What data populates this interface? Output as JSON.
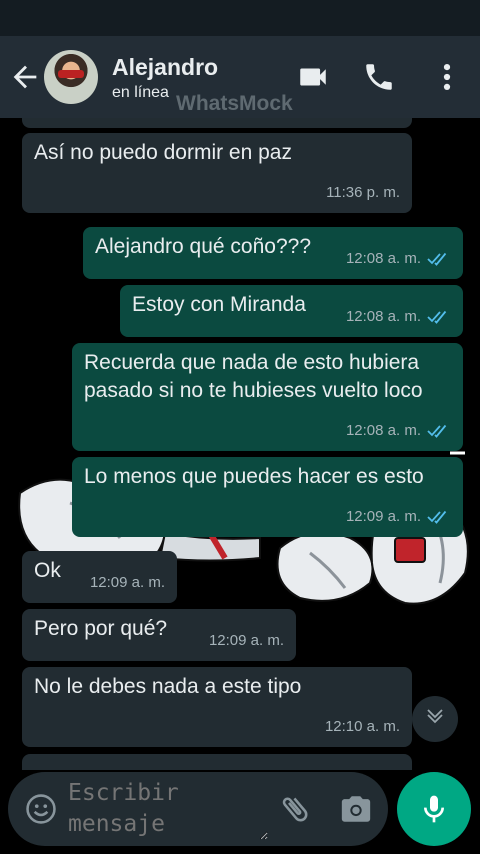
{
  "header": {
    "contact_name": "Alejandro",
    "contact_status": "en línea",
    "watermark": "WhatsMock"
  },
  "messages": [
    {
      "direction": "in",
      "text": "Así no puedo dormir en paz",
      "time": "11:36 p. m."
    },
    {
      "direction": "out",
      "text": "Alejandro qué coño???",
      "time": "12:08 a. m.",
      "read": true
    },
    {
      "direction": "out",
      "text": "Estoy con Miranda",
      "time": "12:08 a. m.",
      "read": true
    },
    {
      "direction": "out",
      "text": "Recuerda que nada de esto hubiera pasado si no te hubieses vuelto loco",
      "time": "12:08 a. m.",
      "read": true
    },
    {
      "direction": "out",
      "text": "Lo menos que puedes hacer es esto",
      "time": "12:09 a. m.",
      "read": true
    },
    {
      "direction": "in",
      "text": "Ok",
      "time": "12:09 a. m."
    },
    {
      "direction": "in",
      "text": "Pero por qué?",
      "time": "12:09 a. m."
    },
    {
      "direction": "in",
      "text": "No le debes nada a este tipo",
      "time": "12:10 a. m."
    }
  ],
  "composer": {
    "placeholder": "Escribir mensaje"
  },
  "colors": {
    "app_bar": "#232d36",
    "incoming_bubble": "#222c32",
    "outgoing_bubble": "#0b4a40",
    "accent": "#00a884",
    "read_ticks": "#53bdeb"
  },
  "icons": [
    "back-arrow-icon",
    "video-call-icon",
    "phone-icon",
    "more-options-icon",
    "double-check-icon",
    "chevron-down-icon",
    "emoji-icon",
    "attach-icon",
    "camera-icon",
    "mic-icon"
  ]
}
